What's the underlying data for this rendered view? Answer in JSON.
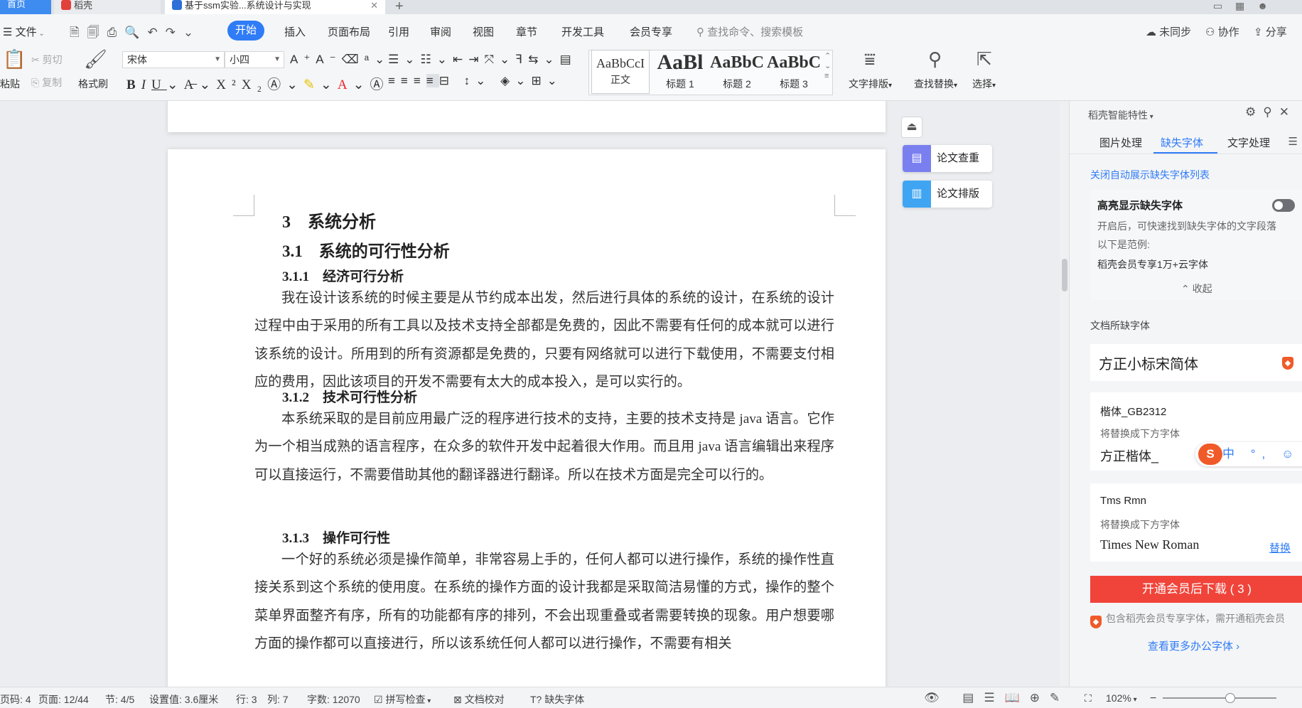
{
  "tabs": {
    "home": "首页",
    "daoke": "稻壳",
    "doc": "基于ssm实验...系统设计与实现"
  },
  "menu": {
    "file": "文件",
    "items": [
      "开始",
      "插入",
      "页面布局",
      "引用",
      "审阅",
      "视图",
      "章节",
      "开发工具",
      "会员专享"
    ],
    "search_placeholder": "查找命令、搜索模板",
    "sync": "未同步",
    "collab": "协作",
    "share": "分享"
  },
  "ribbon": {
    "paste": "粘贴",
    "cut": "剪切",
    "copy": "复制",
    "format_painter": "格式刷",
    "font_name": "宋体",
    "font_size": "小四",
    "styles": [
      {
        "sample": "AaBbCcI",
        "label": "正文"
      },
      {
        "sample": "AaBl",
        "label": "标题 1"
      },
      {
        "sample": "AaBbC",
        "label": "标题 2"
      },
      {
        "sample": "AaBbC",
        "label": "标题 3"
      }
    ],
    "text_layout": "文字排版",
    "find_replace": "查找替换",
    "select": "选择"
  },
  "document": {
    "h1": "3　系统分析",
    "h2": "3.1　系统的可行性分析",
    "sections": [
      {
        "heading": "3.1.1　经济可行分析",
        "text": "我在设计该系统的时候主要是从节约成本出发，然后进行具体的系统的设计，在系统的设计过程中由于采用的所有工具以及技术支持全部都是免费的，因此不需要有任何的成本就可以进行该系统的设计。所用到的所有资源都是免费的，只要有网络就可以进行下载使用，不需要支付相应的费用，因此该项目的开发不需要有太大的成本投入，是可以实行的。"
      },
      {
        "heading": "3.1.2　技术可行性分析",
        "text": "本系统采取的是目前应用最广泛的程序进行技术的支持，主要的技术支持是 java 语言。它作为一个相当成熟的语言程序，在众多的软件开发中起着很大作用。而且用 java 语言编辑出来程序可以直接运行，不需要借助其他的翻译器进行翻译。所以在技术方面是完全可以行的。"
      },
      {
        "heading": "3.1.3　操作可行性",
        "text": "一个好的系统必须是操作简单，非常容易上手的，任何人都可以进行操作，系统的操作性直接关系到这个系统的使用度。在系统的操作方面的设计我都是采取简洁易懂的方式，操作的整个菜单界面整齐有序，所有的功能都有序的排列，不会出现重叠或者需要转换的现象。用户想要哪方面的操作都可以直接进行，所以该系统任何人都可以进行操作，不需要有相关"
      }
    ],
    "float_check": "论文查重",
    "float_layout": "论文排版"
  },
  "panel": {
    "title": "稻壳智能特性",
    "tabs": [
      "图片处理",
      "缺失字体",
      "文字处理"
    ],
    "auto_link": "关闭自动展示缺失字体列表",
    "highlight_title": "高亮显示缺失字体",
    "highlight_desc": "开启后，可快速找到缺失字体的文字段落",
    "example_label": "以下是范例:",
    "example_text": "稻壳会员专享1万+云字体",
    "collapse": "收起",
    "missing_title": "文档所缺字体",
    "missing_fonts": [
      {
        "name": "方正小标宋简体"
      },
      {
        "name": "楷体_GB2312",
        "replace_label": "将替换成下方字体",
        "replacement": "方正楷体_"
      },
      {
        "name": "Tms Rmn",
        "replace_label": "将替换成下方字体",
        "replacement": "Times New Roman",
        "action": "替换"
      }
    ],
    "ime": "中 °, ☺ 🎤 ▦",
    "download_button": "开通会员后下载 ( 3 )",
    "vip_note": "包含稻壳会员专享字体，需开通稻壳会员",
    "more_link": "查看更多办公字体 ›"
  },
  "status": {
    "page_num": "页码: 4",
    "page": "页面: 12/44",
    "section": "节: 4/5",
    "position": "设置值: 3.6厘米",
    "row": "行: 3",
    "col": "列: 7",
    "words": "字数: 12070",
    "spell": "拼写检查",
    "proofread": "文档校对",
    "missing_font": "缺失字体",
    "zoom": "102%"
  }
}
